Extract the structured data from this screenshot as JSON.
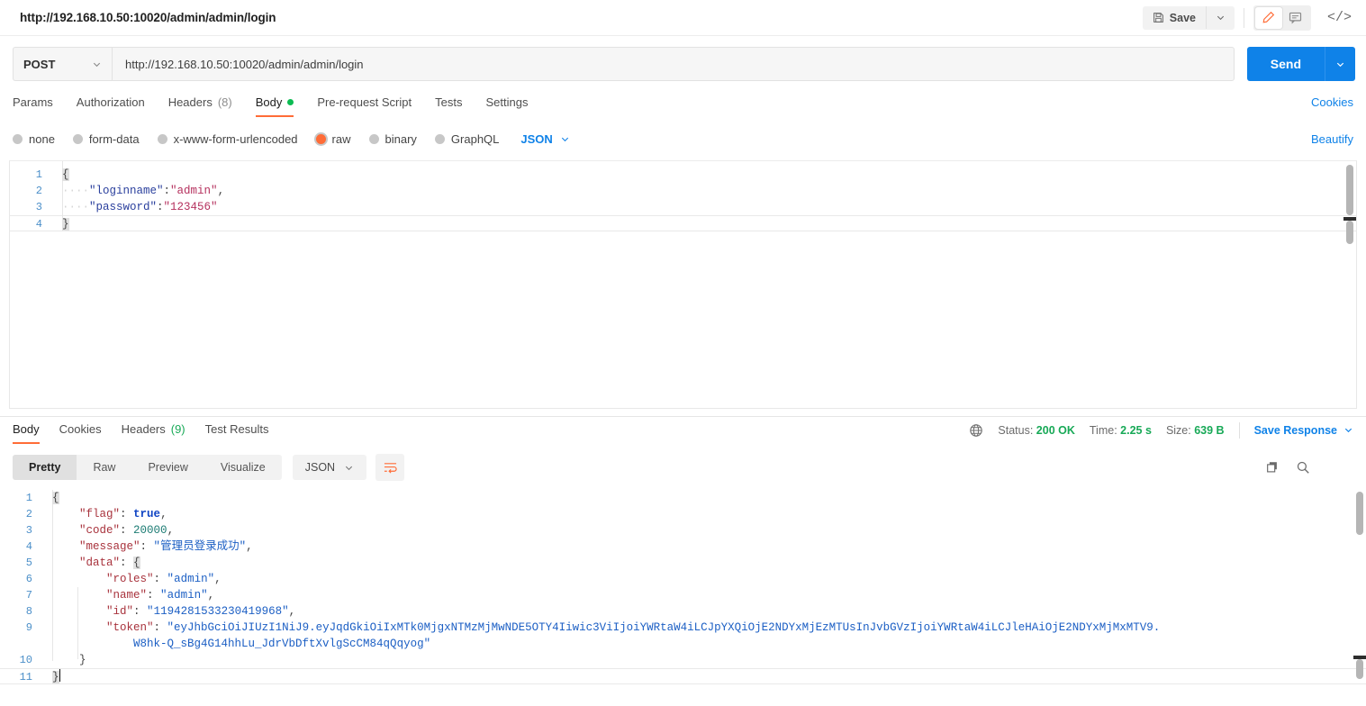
{
  "titlebar": {
    "request_title": "http://192.168.10.50:10020/admin/admin/login",
    "save_label": "Save",
    "save_icon": "floppy-disk-icon",
    "save_caret_icon": "chevron-down-icon",
    "edit_icon": "pencil-icon",
    "comment_icon": "comment-icon",
    "code_icon": "</>"
  },
  "url_row": {
    "method": "POST",
    "method_caret_icon": "chevron-down-icon",
    "url": "http://192.168.10.50:10020/admin/admin/login",
    "send_label": "Send",
    "send_caret_icon": "chevron-down-icon"
  },
  "request_tabs": {
    "items": [
      {
        "label": "Params",
        "active": false
      },
      {
        "label": "Authorization",
        "active": false
      },
      {
        "label": "Headers",
        "count": "(8)",
        "active": false
      },
      {
        "label": "Body",
        "active": true,
        "dot": true
      },
      {
        "label": "Pre-request Script",
        "active": false
      },
      {
        "label": "Tests",
        "active": false
      },
      {
        "label": "Settings",
        "active": false
      }
    ],
    "cookies_link": "Cookies"
  },
  "body_type": {
    "options": [
      {
        "label": "none",
        "selected": false
      },
      {
        "label": "form-data",
        "selected": false
      },
      {
        "label": "x-www-form-urlencoded",
        "selected": false
      },
      {
        "label": "raw",
        "selected": true
      },
      {
        "label": "binary",
        "selected": false
      },
      {
        "label": "GraphQL",
        "selected": false
      }
    ],
    "format": "JSON",
    "format_caret_icon": "chevron-down-icon",
    "beautify_link": "Beautify"
  },
  "request_body": {
    "lines": [
      {
        "n": "1",
        "text": "{"
      },
      {
        "n": "2",
        "text": "    \"loginname\":\"admin\","
      },
      {
        "n": "3",
        "text": "    \"password\":\"123456\""
      },
      {
        "n": "4",
        "text": "}"
      }
    ]
  },
  "response_tabs": {
    "items": [
      {
        "label": "Body",
        "active": true
      },
      {
        "label": "Cookies",
        "active": false
      },
      {
        "label": "Headers",
        "count": "(9)",
        "active": false
      },
      {
        "label": "Test Results",
        "active": false
      }
    ]
  },
  "response_meta": {
    "globe_icon": "globe-icon",
    "status_label": "Status:",
    "status_value": "200 OK",
    "time_label": "Time:",
    "time_value": "2.25 s",
    "size_label": "Size:",
    "size_value": "639 B",
    "save_response_label": "Save Response",
    "save_response_caret_icon": "chevron-down-icon"
  },
  "response_tools": {
    "views": [
      {
        "label": "Pretty",
        "on": true
      },
      {
        "label": "Raw",
        "on": false
      },
      {
        "label": "Preview",
        "on": false
      },
      {
        "label": "Visualize",
        "on": false
      }
    ],
    "format": "JSON",
    "format_caret_icon": "chevron-down-icon",
    "wrap_icon": "word-wrap-icon",
    "copy_icon": "copy-icon",
    "search_icon": "search-icon"
  },
  "response_body": {
    "lines": [
      {
        "n": "1",
        "text": "{"
      },
      {
        "n": "2",
        "text": "    \"flag\": true,"
      },
      {
        "n": "3",
        "text": "    \"code\": 20000,"
      },
      {
        "n": "4",
        "text": "    \"message\": \"管理员登录成功\","
      },
      {
        "n": "5",
        "text": "    \"data\": {"
      },
      {
        "n": "6",
        "text": "        \"roles\": \"admin\","
      },
      {
        "n": "7",
        "text": "        \"name\": \"admin\","
      },
      {
        "n": "8",
        "text": "        \"id\": \"1194281533230419968\","
      },
      {
        "n": "9",
        "text": "        \"token\": \"eyJhbGciOiJIUzI1NiJ9.eyJqdGkiOiIxMTk0MjgxNTMzMjMwNDE5OTY4Iiwic3ViIjoiYWRtaW4iLCJpYXQiOjE2NDYxMjEzMTUsInJvbGVzIjoiYWRtaW4iLCJleHAiOjE2NDYxMjMxMTV9."
      },
      {
        "n": "",
        "text": "            W8hk-Q_sBg4G14hhLu_JdrVbDftXvlgScCM84qQqyog\""
      },
      {
        "n": "10",
        "text": "    }"
      },
      {
        "n": "11",
        "text": "}"
      }
    ],
    "token_value": "eyJhbGciOiJIUzI1NiJ9.eyJqdGkiOiIxMTk0MjgxNTMzMjMwNDE5OTY4Iiwic3ViIjoiYWRtaW4iLCJpYXQiOjE2NDYxMjEzMTUsInJvbGVzIjoiYWRtaW4iLCJleHAiOjE2NDYxMjMxMTV9.W8hk-Q_sBg4G14hhLu_JdrVbDftXvlgScCM84qQqyog",
    "id_value": "1194281533230419968",
    "message_value": "管理员登录成功",
    "flag_value": "true",
    "code_value": "20000",
    "roles_value": "admin",
    "name_value": "admin"
  },
  "colors": {
    "accent_orange": "#ff6c37",
    "accent_blue": "#0f82e8",
    "status_green": "#18a957"
  }
}
